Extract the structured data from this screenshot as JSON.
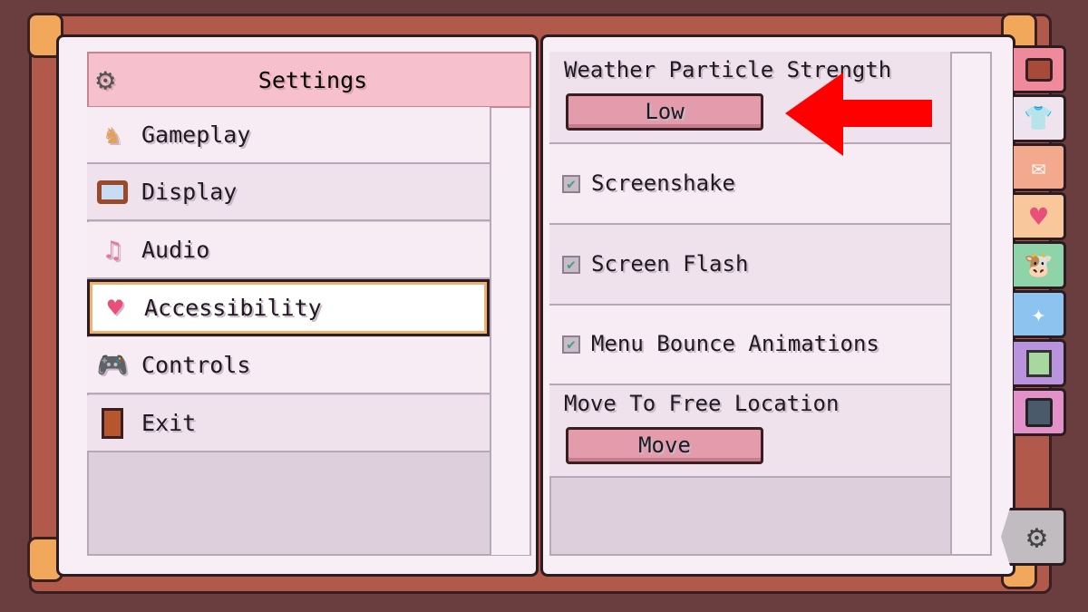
{
  "menu": {
    "title": "Settings",
    "title_icon": "gear-icon",
    "items": [
      {
        "label": "Gameplay",
        "icon": "chess-knight-icon"
      },
      {
        "label": "Display",
        "icon": "tv-icon"
      },
      {
        "label": "Audio",
        "icon": "music-notes-icon"
      },
      {
        "label": "Accessibility",
        "icon": "heart-icon",
        "selected": true
      },
      {
        "label": "Controls",
        "icon": "gamepad-icon"
      },
      {
        "label": "Exit",
        "icon": "door-icon"
      }
    ]
  },
  "options": {
    "weather": {
      "label": "Weather Particle Strength",
      "value": "Low"
    },
    "screenshake": {
      "label": "Screenshake",
      "checked": true
    },
    "flash": {
      "label": "Screen Flash",
      "checked": true
    },
    "bounce": {
      "label": "Menu Bounce Animations",
      "checked": true
    },
    "move": {
      "label": "Move To Free Location",
      "button": "Move"
    }
  },
  "tabs": [
    {
      "icon": "backpack-icon",
      "color": "#ee8a9c"
    },
    {
      "icon": "shirt-icon",
      "color": "#efe3ee"
    },
    {
      "icon": "mail-icon",
      "color": "#f2a98e"
    },
    {
      "icon": "heart-icon",
      "color": "#f8c79b"
    },
    {
      "icon": "cow-icon",
      "color": "#8fd3a8"
    },
    {
      "icon": "sparkles-icon",
      "color": "#8cc3ef"
    },
    {
      "icon": "map-icon",
      "color": "#b993dc"
    },
    {
      "icon": "journal-icon",
      "color": "#e392c9"
    },
    {
      "icon": "gear-icon",
      "color": "#c0bcc0",
      "active": true
    }
  ],
  "annotation": {
    "arrow_color": "#ff0000"
  }
}
